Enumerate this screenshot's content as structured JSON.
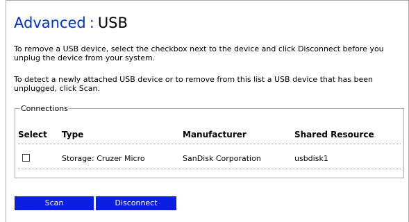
{
  "header": {
    "section": "Advanced",
    "separator": ":",
    "page": "USB"
  },
  "instructions": {
    "remove": "To remove a USB device, select the checkbox next to the device and click Disconnect before you unplug the device from your system.",
    "detect": "To detect a newly attached USB device or to remove from this list a USB device that has been unplugged, click Scan."
  },
  "connections": {
    "legend": "Connections",
    "columns": [
      "Select",
      "Type",
      "Manufacturer",
      "Shared Resource"
    ],
    "rows": [
      {
        "selected": false,
        "type": "Storage: Cruzer Micro",
        "manufacturer": "SanDisk Corporation",
        "shared_resource": "usbdisk1"
      }
    ]
  },
  "buttons": {
    "scan": "Scan",
    "disconnect": "Disconnect"
  },
  "colors": {
    "title_accent": "#0033cc",
    "button_bg": "#0a1fe0",
    "button_text": "#ffffff",
    "border": "#a8a8a8"
  }
}
